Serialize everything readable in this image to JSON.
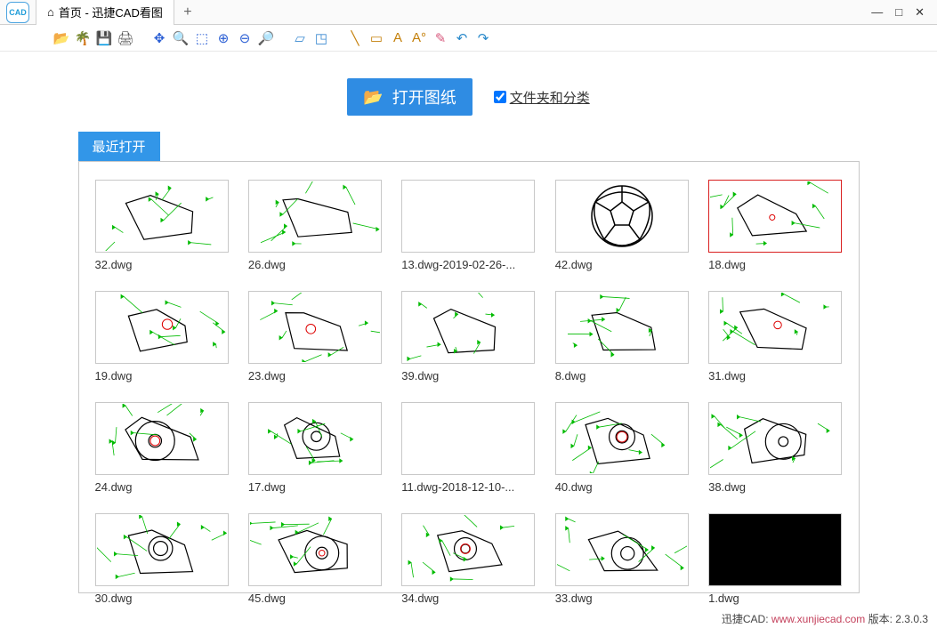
{
  "appName": "CAD",
  "tab": {
    "title": "首页 - 迅捷CAD看图"
  },
  "winControls": {
    "min": "—",
    "max": "□",
    "close": "✕"
  },
  "toolbar": {
    "open": "📂",
    "tree": "🌴",
    "save": "💾",
    "print": "🖨",
    "pan": "✥",
    "zoomExt": "🔍",
    "window": "⬚",
    "zoomIn": "⊕",
    "zoomOut": "⊖",
    "zoomAll": "🔎",
    "iso1": "▱",
    "iso2": "◳",
    "line": "╲",
    "rect": "▭",
    "text": "A",
    "dim": "A°",
    "erase": "✎",
    "undo": "↶",
    "redo": "↷"
  },
  "openButton": "打开图纸",
  "folderCheckbox": "文件夹和分类",
  "recentLabel": "最近打开",
  "files": [
    {
      "name": "32.dwg",
      "thumb": "cad1"
    },
    {
      "name": "26.dwg",
      "thumb": "cad2"
    },
    {
      "name": "13.dwg-2019-02-26-...",
      "thumb": "blank"
    },
    {
      "name": "42.dwg",
      "thumb": "ball"
    },
    {
      "name": "18.dwg",
      "thumb": "cad3",
      "selected": true
    },
    {
      "name": "19.dwg",
      "thumb": "cad4"
    },
    {
      "name": "23.dwg",
      "thumb": "cad5"
    },
    {
      "name": "39.dwg",
      "thumb": "cad6"
    },
    {
      "name": "8.dwg",
      "thumb": "cad7"
    },
    {
      "name": "31.dwg",
      "thumb": "cad8"
    },
    {
      "name": "24.dwg",
      "thumb": "cad9"
    },
    {
      "name": "17.dwg",
      "thumb": "cad10"
    },
    {
      "name": "11.dwg-2018-12-10-...",
      "thumb": "blank"
    },
    {
      "name": "40.dwg",
      "thumb": "cad11"
    },
    {
      "name": "38.dwg",
      "thumb": "cad12"
    },
    {
      "name": "30.dwg",
      "thumb": "cad13"
    },
    {
      "name": "45.dwg",
      "thumb": "cad14"
    },
    {
      "name": "34.dwg",
      "thumb": "cad15"
    },
    {
      "name": "33.dwg",
      "thumb": "cad16"
    },
    {
      "name": "1.dwg",
      "thumb": "black"
    }
  ],
  "status": {
    "product": "迅捷CAD: ",
    "url": "www.xunjiecad.com",
    "versionLabel": " 版本: ",
    "version": "2.3.0.3"
  }
}
